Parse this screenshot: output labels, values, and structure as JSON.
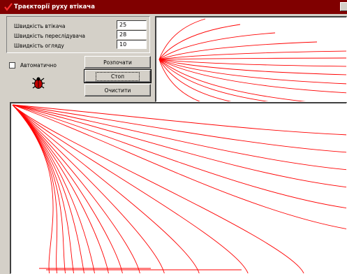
{
  "window": {
    "title": "Траєкторії руху втікача"
  },
  "params": [
    {
      "label": "Швидкість втікача",
      "value": "25"
    },
    {
      "label": "Швидкість переслідувача",
      "value": "28"
    },
    {
      "label": "Швидкість огляду",
      "value": "10"
    }
  ],
  "controls": {
    "auto_label": "Автоматично",
    "auto_checked": false,
    "start_label": "Розпочати",
    "stop_label": "Стоп",
    "clear_label": "Очистити"
  },
  "colors": {
    "title_bar": "#800000",
    "trajectory": "#ff0000",
    "background": "#d4d0c8"
  },
  "icons": {
    "app": "check-icon",
    "bug": "bug-icon"
  }
}
